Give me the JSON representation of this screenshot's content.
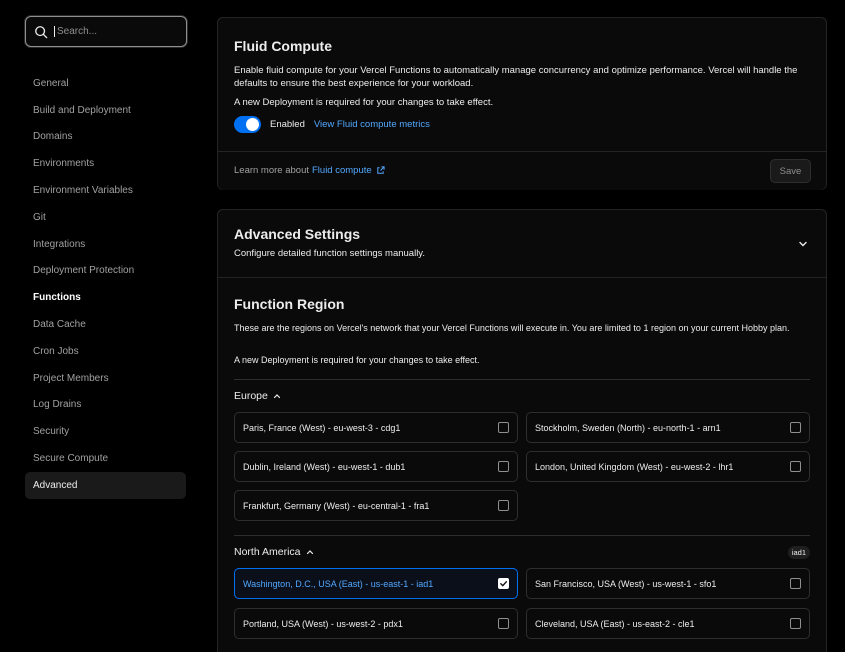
{
  "search": {
    "placeholder": "Search..."
  },
  "sidebar": {
    "items": [
      {
        "label": "General"
      },
      {
        "label": "Build and Deployment"
      },
      {
        "label": "Domains"
      },
      {
        "label": "Environments"
      },
      {
        "label": "Environment Variables"
      },
      {
        "label": "Git"
      },
      {
        "label": "Integrations"
      },
      {
        "label": "Deployment Protection"
      },
      {
        "label": "Functions"
      },
      {
        "label": "Data Cache"
      },
      {
        "label": "Cron Jobs"
      },
      {
        "label": "Project Members"
      },
      {
        "label": "Log Drains"
      },
      {
        "label": "Security"
      },
      {
        "label": "Secure Compute"
      },
      {
        "label": "Advanced"
      }
    ]
  },
  "fluid": {
    "title": "Fluid Compute",
    "description": "Enable fluid compute for your Vercel Functions to automatically manage concurrency and optimize performance. Vercel will handle the defaults to ensure the best experience for your workload.",
    "notice": "A new Deployment is required for your changes to take effect.",
    "toggle_label": "Enabled",
    "metrics_link": "View Fluid compute metrics",
    "learn_prefix": "Learn more about",
    "learn_link": "Fluid compute",
    "save_label": "Save"
  },
  "advanced": {
    "title": "Advanced Settings",
    "description": "Configure detailed function settings manually."
  },
  "region": {
    "title": "Function Region",
    "description": "These are the regions on Vercel's network that your Vercel Functions will execute in. You are limited to 1 region on your current Hobby plan.",
    "notice": "A new Deployment is required for your changes to take effect.",
    "europe_label": "Europe",
    "europe": [
      {
        "label": "Paris, France (West) - eu-west-3 - cdg1",
        "checked": false
      },
      {
        "label": "Stockholm, Sweden (North) - eu-north-1 - arn1",
        "checked": false
      },
      {
        "label": "Dublin, Ireland (West) - eu-west-1 - dub1",
        "checked": false
      },
      {
        "label": "London, United Kingdom (West) - eu-west-2 - lhr1",
        "checked": false
      },
      {
        "label": "Frankfurt, Germany (West) - eu-central-1 - fra1",
        "checked": false
      }
    ],
    "na_label": "North America",
    "na_badge": "iad1",
    "north_america": [
      {
        "label": "Washington, D.C., USA (East) - us-east-1 - iad1",
        "checked": true
      },
      {
        "label": "San Francisco, USA (West) - us-west-1 - sfo1",
        "checked": false
      },
      {
        "label": "Portland, USA (West) - us-west-2 - pdx1",
        "checked": false
      },
      {
        "label": "Cleveland, USA (East) - us-east-2 - cle1",
        "checked": false
      }
    ]
  },
  "colors": {
    "accent": "#0070f3",
    "link": "#52a8ff",
    "background": "#000000",
    "card": "#0a0a0a",
    "border": "#242424"
  }
}
